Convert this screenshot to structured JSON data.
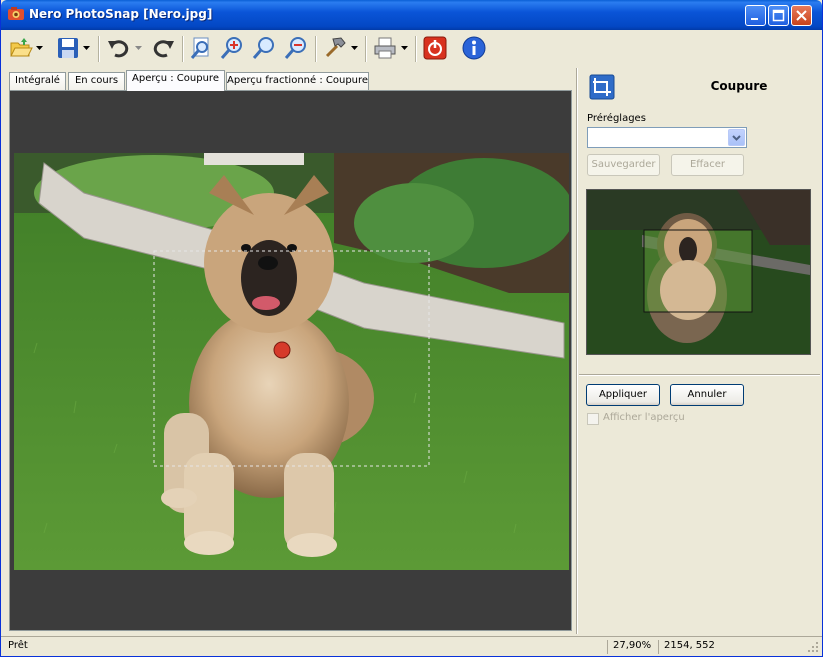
{
  "window": {
    "title": "Nero PhotoSnap   [Nero.jpg]"
  },
  "toolbar": {
    "items": [
      {
        "name": "open-folder-icon",
        "dropdown": true
      },
      {
        "name": "save-icon",
        "dropdown": true
      },
      {
        "name": "undo-icon",
        "dropdown": true
      },
      {
        "name": "redo-icon",
        "dropdown": false
      },
      {
        "name": "zoom-fit-icon",
        "dropdown": false
      },
      {
        "name": "zoom-in-icon",
        "dropdown": false
      },
      {
        "name": "zoom-actual-icon",
        "dropdown": false
      },
      {
        "name": "zoom-out-icon",
        "dropdown": false
      },
      {
        "name": "tools-hammer-icon",
        "dropdown": true
      },
      {
        "name": "print-icon",
        "dropdown": true
      },
      {
        "name": "exit-icon",
        "dropdown": false
      },
      {
        "name": "info-icon",
        "dropdown": false
      }
    ]
  },
  "tabs": [
    {
      "label": "Intégralé",
      "active": false
    },
    {
      "label": "En cours",
      "active": false
    },
    {
      "label": "Aperçu : Coupure",
      "active": true
    },
    {
      "label": "Aperçu fractionné : Coupure",
      "active": false
    }
  ],
  "panel": {
    "title": "Coupure",
    "presets_label": "Préréglages",
    "presets_value": "",
    "save_label": "Sauvegarder",
    "delete_label": "Effacer",
    "apply_label": "Appliquer",
    "cancel_label": "Annuler",
    "show_preview_label": "Afficher l'aperçu",
    "show_preview_checked": false
  },
  "status": {
    "left": "Prêt",
    "zoom": "27,90%",
    "coords": "2154, 552"
  },
  "colors": {
    "titlebar": "#0a55d8",
    "viewer_background": "#3c3c3c",
    "grass": "#4f8f2e"
  }
}
